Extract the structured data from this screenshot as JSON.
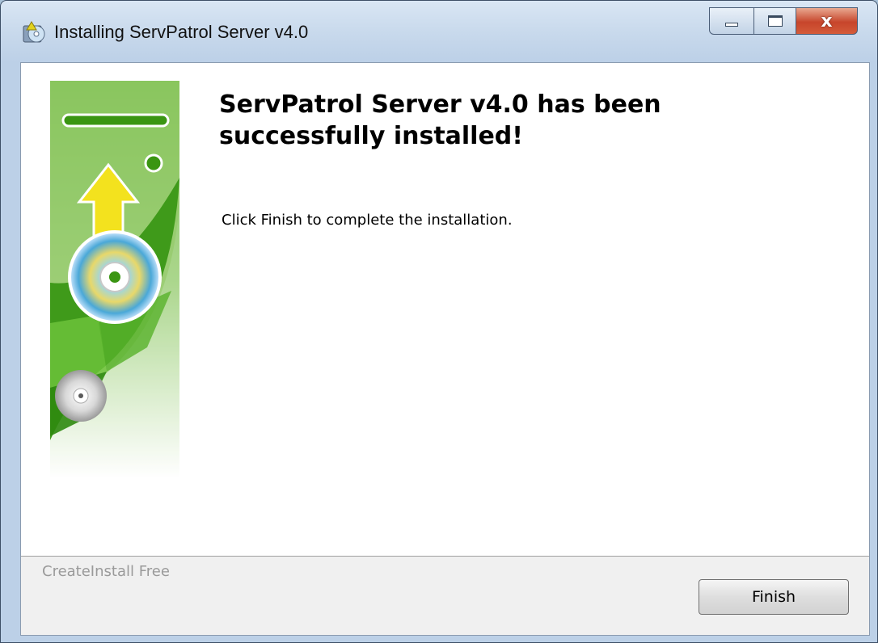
{
  "window": {
    "title": "Installing ServPatrol Server v4.0"
  },
  "controls": {
    "minimize_icon": "minimize-icon",
    "maximize_icon": "maximize-icon",
    "close_glyph": "x"
  },
  "content": {
    "heading": "ServPatrol Server v4.0 has been successfully installed!",
    "description": "Click Finish to complete the installation."
  },
  "footer": {
    "brand": "CreateInstall Free",
    "finish_label": "Finish"
  },
  "colors": {
    "accent_green": "#5cb82a",
    "arrow_yellow": "#f3e21e",
    "close_red": "#c7452b"
  }
}
